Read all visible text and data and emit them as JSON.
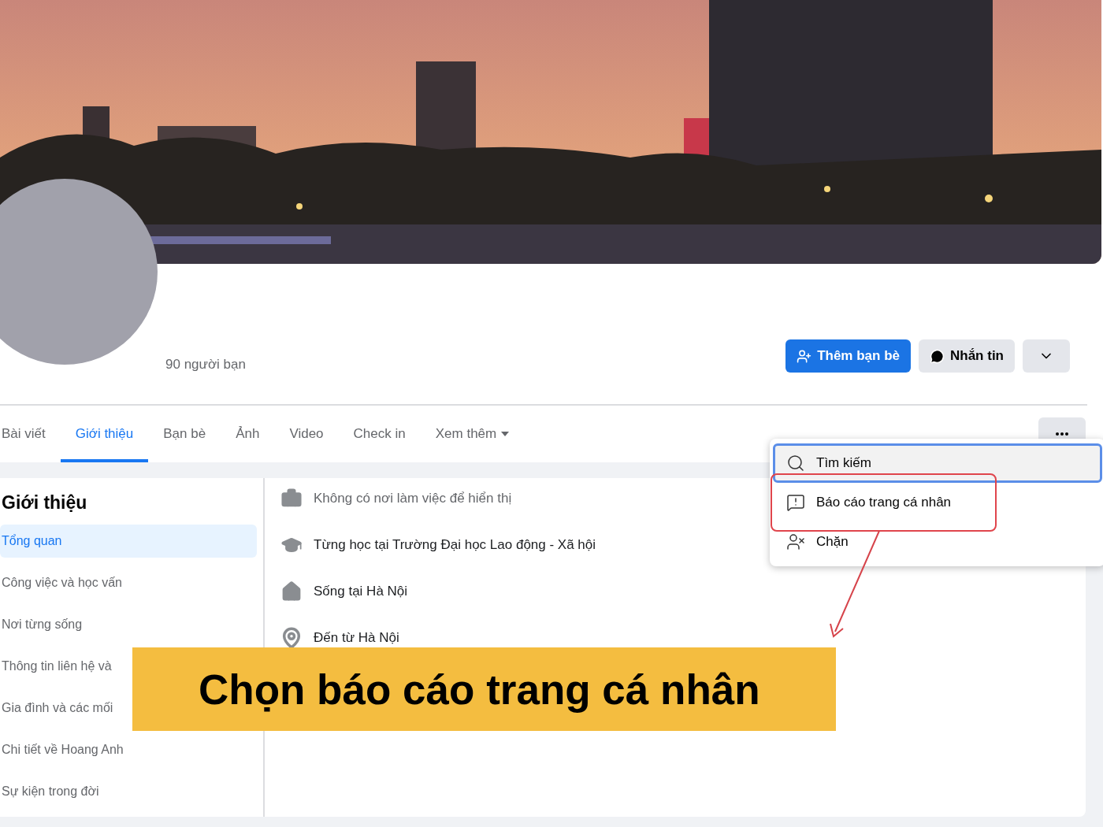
{
  "profile": {
    "friends_count": "90 người bạn"
  },
  "actions": [
    {
      "kind": "primary",
      "label": "Thêm bạn bè"
    },
    {
      "kind": "secondary",
      "label": "Nhắn tin"
    },
    {
      "kind": "dropdown"
    }
  ],
  "tabs": [
    {
      "label": "Bài viết",
      "selected": false,
      "has_caret": false
    },
    {
      "label": "Giới thiệu",
      "selected": true,
      "has_caret": false
    },
    {
      "label": "Bạn bè",
      "selected": false,
      "has_caret": false
    },
    {
      "label": "Ảnh",
      "selected": false,
      "has_caret": false
    },
    {
      "label": "Video",
      "selected": false,
      "has_caret": false
    },
    {
      "label": "Check in",
      "selected": false,
      "has_caret": false
    },
    {
      "label": "Xem thêm",
      "selected": false,
      "has_caret": true
    }
  ],
  "menu": {
    "items": [
      {
        "kind": "search",
        "label": "Tìm kiếm",
        "focused": true
      },
      {
        "kind": "report",
        "label": "Báo cáo trang cá nhân",
        "focused": false
      },
      {
        "kind": "block",
        "label": "Chặn",
        "focused": false
      }
    ]
  },
  "sidebar": {
    "title": "Giới thiệu",
    "items": [
      {
        "label": "Tổng quan",
        "selected": true
      },
      {
        "label": "Công việc và học vấn",
        "selected": false
      },
      {
        "label": "Nơi từng sống",
        "selected": false
      },
      {
        "label": "Thông tin liên hệ và",
        "selected": false
      },
      {
        "label": "Gia đình và các mối",
        "selected": false
      },
      {
        "label": "Chi tiết về Hoang Anh",
        "selected": false
      },
      {
        "label": "Sự kiện trong đời",
        "selected": false
      }
    ]
  },
  "overview": [
    {
      "kind": "work",
      "text": "Không có nơi làm việc để hiển thị"
    },
    {
      "kind": "school",
      "text": "Từng học tại Trường Đại học Lao động - Xã hội"
    },
    {
      "kind": "home",
      "text": "Sống tại Hà Nội"
    },
    {
      "kind": "place",
      "text": "Đến từ Hà Nội"
    }
  ],
  "annotation": {
    "caption": "Chọn báo cáo trang cá nhân"
  }
}
